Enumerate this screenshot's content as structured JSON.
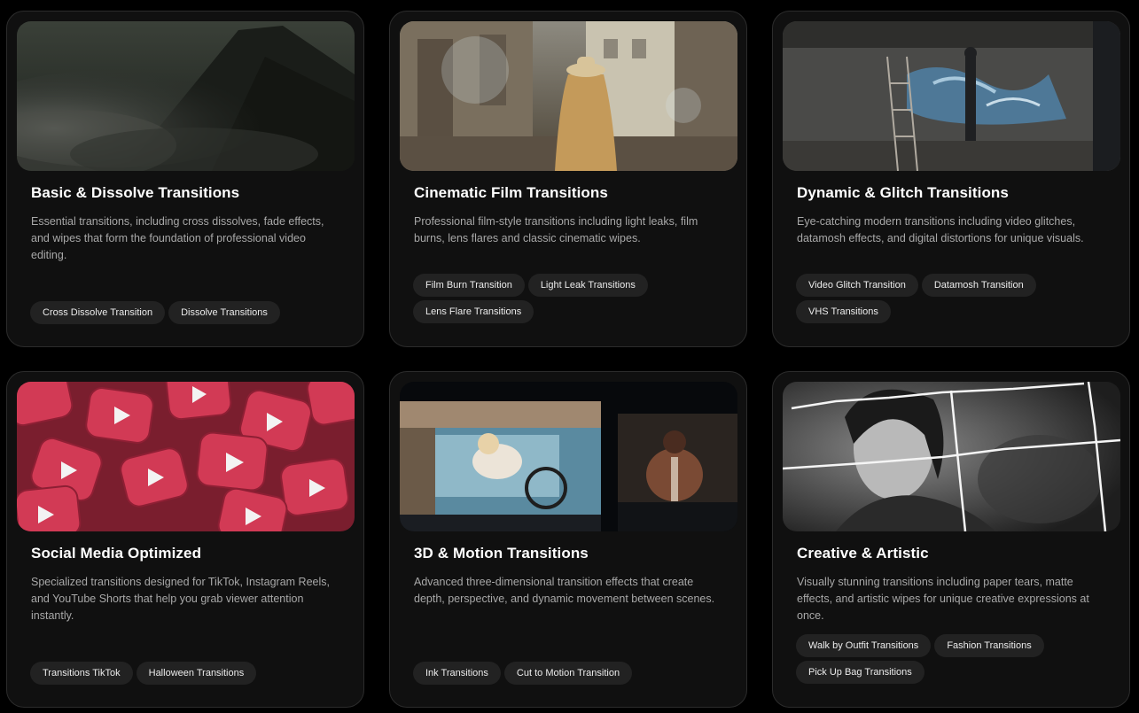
{
  "cards": [
    {
      "title": "Basic & Dissolve Transitions",
      "description": "Essential transitions, including cross dissolves, fade effects, and wipes that form the foundation of professional video editing.",
      "tags": [
        "Cross Dissolve Transition",
        "Dissolve Transitions"
      ],
      "thumbnail_icon": "mountain-clouds-image"
    },
    {
      "title": "Cinematic Film Transitions",
      "description": "Professional film-style transitions including light leaks, film burns, lens flares and classic cinematic wipes.",
      "tags": [
        "Film Burn Transition",
        "Light Leak Transitions",
        "Lens Flare Transitions"
      ],
      "thumbnail_icon": "street-woman-hat-image"
    },
    {
      "title": "Dynamic & Glitch Transitions",
      "description": "Eye-catching modern transitions including video glitches, datamosh effects, and digital distortions for unique visuals.",
      "tags": [
        "Video Glitch Transition",
        "Datamosh Transition",
        "VHS Transitions"
      ],
      "thumbnail_icon": "graffiti-wall-image"
    },
    {
      "title": "Social Media Optimized",
      "description": "Specialized transitions designed for TikTok, Instagram Reels, and YouTube Shorts that help you grab viewer attention instantly.",
      "tags": [
        "Transitions TikTok",
        "Halloween Transitions"
      ],
      "thumbnail_icon": "youtube-play-buttons-image"
    },
    {
      "title": "3D & Motion Transitions",
      "description": "Advanced three-dimensional transition effects that create depth, perspective, and dynamic movement between scenes.",
      "tags": [
        "Ink Transitions",
        "Cut to Motion Transition"
      ],
      "thumbnail_icon": "3d-panels-image"
    },
    {
      "title": "Creative & Artistic",
      "description": "Visually stunning transitions including paper tears, matte effects, and artistic wipes for unique creative expressions at once.",
      "tags": [
        "Walk by Outfit Transitions",
        "Fashion Transitions",
        "Pick Up Bag Transitions"
      ],
      "thumbnail_icon": "paper-tear-portrait-image"
    }
  ],
  "colors": {
    "page_bg": "#000000",
    "card_bg": "#101010",
    "card_border": "#2c2c2c",
    "tag_bg": "#222222",
    "title": "#ffffff",
    "description": "#a8a8a8"
  }
}
